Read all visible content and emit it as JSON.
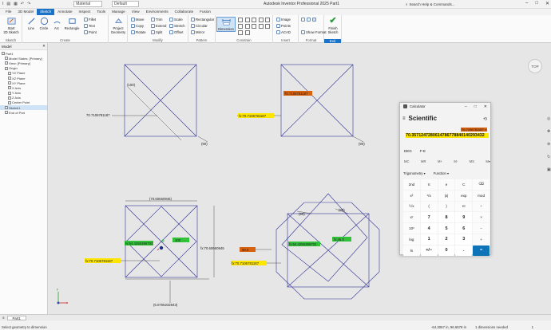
{
  "titlebar": {
    "app_title": "Autodesk Inventor Professional 2025   Part1",
    "search_placeholder": "Search Help & Commands...",
    "quick_material": "Material",
    "quick_default": "Default",
    "window_controls": [
      "–",
      "□",
      "✕"
    ]
  },
  "tabs": [
    "File",
    "3D Model",
    "Sketch",
    "Annotate",
    "Inspect",
    "Tools",
    "Manage",
    "View",
    "Environments",
    "Collaborate",
    "Fusion"
  ],
  "active_tab": "Sketch",
  "ribbon": {
    "start": {
      "label": "Start\n2D Sketch",
      "group": "Sketch"
    },
    "create": {
      "line": "Line",
      "circle": "Circle",
      "arc": "Arc",
      "rectangle": "Rectangle",
      "fillet": "Fillet",
      "text": "Text",
      "point": "Point",
      "group": "Create"
    },
    "project_geometry": "Project\nGeometry",
    "modify": {
      "move": "Move",
      "trim": "Trim",
      "scale": "Scale",
      "copy": "Copy",
      "extend": "Extend",
      "stretch": "Stretch",
      "rotate": "Rotate",
      "split": "Split",
      "offset": "Offset",
      "group": "Modify"
    },
    "pattern": {
      "rectangular": "Rectangular",
      "circular": "Circular",
      "mirror": "Mirror",
      "group": "Pattern"
    },
    "constrain": {
      "dimension": "Dimension",
      "group": "Constrain"
    },
    "insert": {
      "image": "Image",
      "points": "Points",
      "acad": "ACAD",
      "group": "Insert"
    },
    "format": {
      "show_format": "Show Format",
      "group": "Format"
    },
    "finish": {
      "label": "Finish\nSketch",
      "group": "Exit"
    }
  },
  "browser": {
    "title": "Model",
    "items": [
      {
        "label": "Part1",
        "indent": 0
      },
      {
        "label": "Model States: [Primary]",
        "indent": 1
      },
      {
        "label": "View: [Primary]",
        "indent": 1
      },
      {
        "label": "Origin",
        "indent": 1
      },
      {
        "label": "YZ Plane",
        "indent": 2
      },
      {
        "label": "XZ Plane",
        "indent": 2
      },
      {
        "label": "XY Plane",
        "indent": 2
      },
      {
        "label": "X Axis",
        "indent": 2
      },
      {
        "label": "Y Axis",
        "indent": 2
      },
      {
        "label": "Z Axis",
        "indent": 2
      },
      {
        "label": "Center Point",
        "indent": 2
      },
      {
        "label": "Sketch1",
        "indent": 1,
        "selected": true
      },
      {
        "label": "End of Part",
        "indent": 1
      }
    ]
  },
  "canvas": {
    "view_cube": "TOP",
    "dims": {
      "d1": "(100)",
      "d2": "70.7106781187",
      "d3": "(90)",
      "d4": "70.7106781187",
      "d5": "fx:70.7106781187",
      "d6": "(90)",
      "d7": "(70.60660945)",
      "d8": "fx:70.60660945",
      "d9": "(6.0705232943)",
      "d10": "fx:70.7106781187",
      "d11": "fx:64.4256396702",
      "d12": "100",
      "d13": "(90)",
      "d14": "(90)",
      "d15": "fx:64.4256396702",
      "d16": "fx:45.0",
      "d17": "fx:70.7106781187",
      "d18": "90.0"
    }
  },
  "calculator": {
    "title": "Calculator",
    "mode": "Scientific",
    "expression": "70.7106781187 =",
    "display": "70.3571247280614786778840140293432",
    "angle": [
      "DEG",
      "F-E"
    ],
    "memory": [
      "MC",
      "MR",
      "M+",
      "M-",
      "MS",
      "M▾"
    ],
    "functions": [
      "Trigonometry ▾",
      "Function ▾"
    ],
    "keys": [
      "2nd",
      "π",
      "e",
      "C",
      "⌫",
      "x²",
      "¹/x",
      "|x|",
      "exp",
      "mod",
      "²√x",
      "(",
      ")",
      "n!",
      "÷",
      "xʸ",
      "7",
      "8",
      "9",
      "×",
      "10ˣ",
      "4",
      "5",
      "6",
      "−",
      "log",
      "1",
      "2",
      "3",
      "+",
      "ln",
      "+/−",
      "0",
      ".",
      "="
    ]
  },
  "status": {
    "doc_tab": "Part1",
    "message": "Select geometry to dimension",
    "coords": "-64.3067 in, 96.6578 in",
    "dims": "1 dimensions needed",
    "count": "1"
  }
}
